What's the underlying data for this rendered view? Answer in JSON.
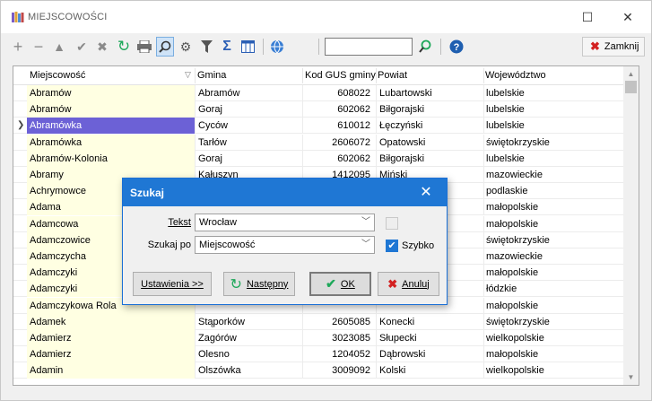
{
  "window": {
    "title": "MIEJSCOWOŚCI",
    "close_label": "Zamknij"
  },
  "toolbar": {
    "icons": [
      "add-icon",
      "remove-icon",
      "edit-icon",
      "confirm-icon",
      "cancel-icon",
      "refresh-icon",
      "print-icon",
      "search-icon",
      "settings-icon",
      "filter-icon",
      "sum-icon",
      "columns-icon",
      "globe-icon",
      "find-next-icon",
      "help-icon"
    ],
    "search_value": ""
  },
  "grid": {
    "columns": [
      "Miejscowość",
      "Gmina",
      "Kod GUS gminy",
      "Powiat",
      "Województwo"
    ],
    "rows": [
      {
        "city": "Abramów",
        "gmina": "Abramów",
        "kod": "608022",
        "powiat": "Lubartowski",
        "woj": "lubelskie"
      },
      {
        "city": "Abramów",
        "gmina": "Goraj",
        "kod": "602062",
        "powiat": "Biłgorajski",
        "woj": "lubelskie"
      },
      {
        "city": "Abramówka",
        "gmina": "Cyców",
        "kod": "610012",
        "powiat": "Łęczyński",
        "woj": "lubelskie"
      },
      {
        "city": "Abramówka",
        "gmina": "Tarłów",
        "kod": "2606072",
        "powiat": "Opatowski",
        "woj": "świętokrzyskie"
      },
      {
        "city": "Abramów-Kolonia",
        "gmina": "Goraj",
        "kod": "602062",
        "powiat": "Biłgorajski",
        "woj": "lubelskie"
      },
      {
        "city": "Abramy",
        "gmina": "Kałuszyn",
        "kod": "1412095",
        "powiat": "Miński",
        "woj": "mazowieckie"
      },
      {
        "city": "Achrymowce",
        "gmina": "",
        "kod": "",
        "powiat": "",
        "woj": "podlaskie"
      },
      {
        "city": "Adama",
        "gmina": "",
        "kod": "",
        "powiat": "",
        "woj": "małopolskie"
      },
      {
        "city": "Adamcowa",
        "gmina": "",
        "kod": "",
        "powiat": "",
        "woj": "małopolskie"
      },
      {
        "city": "Adamczowice",
        "gmina": "",
        "kod": "",
        "powiat": "",
        "woj": "świętokrzyskie"
      },
      {
        "city": "Adamczycha",
        "gmina": "",
        "kod": "",
        "powiat": "",
        "woj": "mazowieckie"
      },
      {
        "city": "Adamczyki",
        "gmina": "",
        "kod": "",
        "powiat": "",
        "woj": "małopolskie"
      },
      {
        "city": "Adamczyki",
        "gmina": "",
        "kod": "",
        "powiat": "",
        "woj": "łódzkie"
      },
      {
        "city": "Adamczykowa Rola",
        "gmina": "",
        "kod": "",
        "powiat": "",
        "woj": "małopolskie"
      },
      {
        "city": "Adamek",
        "gmina": "Stąporków",
        "kod": "2605085",
        "powiat": "Konecki",
        "woj": "świętokrzyskie"
      },
      {
        "city": "Adamierz",
        "gmina": "Zagórów",
        "kod": "3023085",
        "powiat": "Słupecki",
        "woj": "wielkopolskie"
      },
      {
        "city": "Adamierz",
        "gmina": "Olesno",
        "kod": "1204052",
        "powiat": "Dąbrowski",
        "woj": "małopolskie"
      },
      {
        "city": "Adamin",
        "gmina": "Olszówka",
        "kod": "3009092",
        "powiat": "Kolski",
        "woj": "wielkopolskie"
      }
    ],
    "selected_row": 2
  },
  "dialog": {
    "title": "Szukaj",
    "text_label": "Tekst",
    "text_value": "Wrocław",
    "search_by_label": "Szukaj po",
    "search_by_value": "Miejscowość",
    "fast_label": "Szybko",
    "fast_checked": true,
    "settings_button": "Ustawienia >>",
    "next_button": "Następny",
    "ok_button": "OK",
    "cancel_button": "Anuluj"
  }
}
